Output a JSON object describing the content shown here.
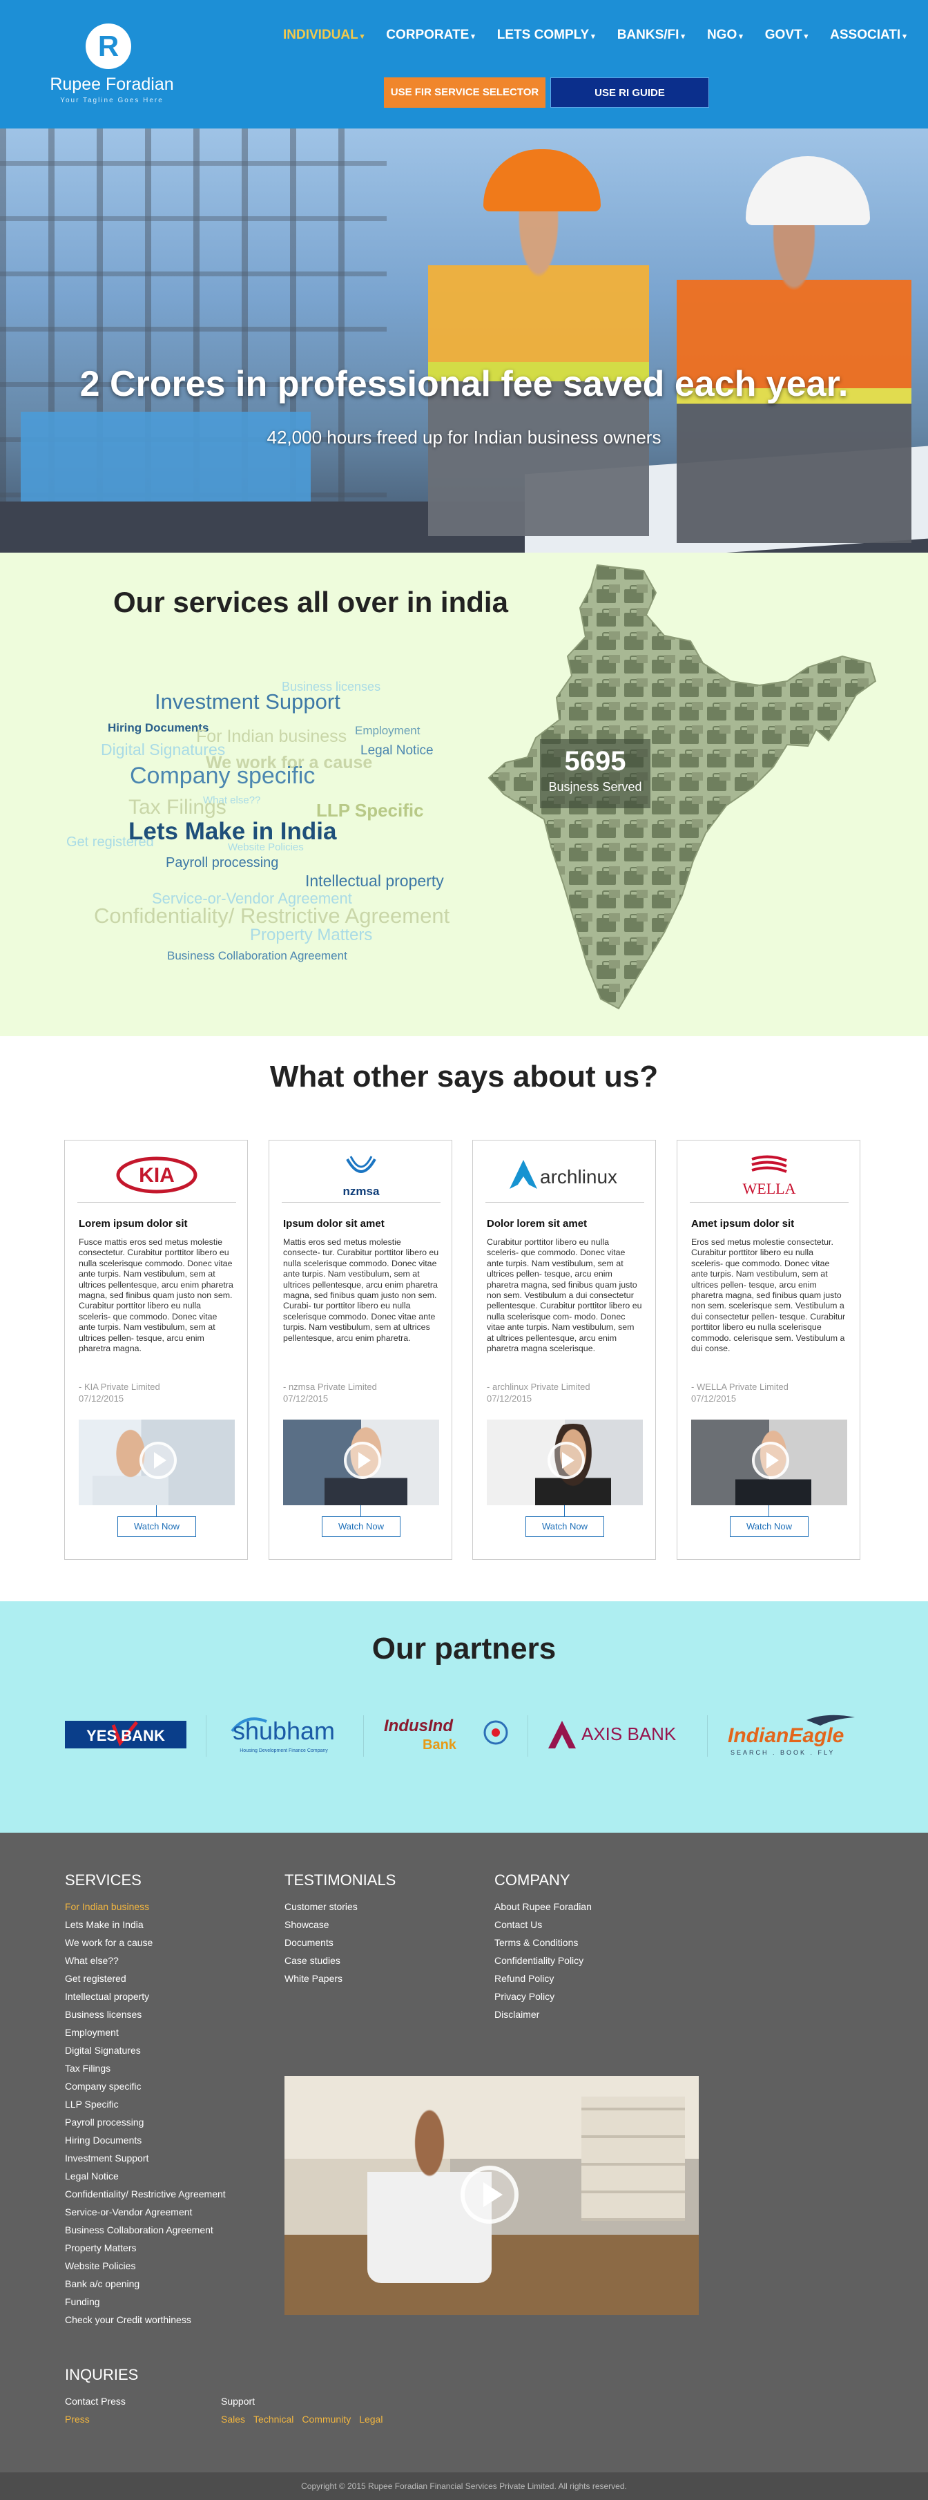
{
  "brand": {
    "initial": "R",
    "name": "Rupee Foradian",
    "tagline": "Your Tagline Goes Here",
    "color": "#1d8fd6"
  },
  "nav": {
    "items": [
      {
        "label": "INDIVIDUAL",
        "active": true
      },
      {
        "label": "CORPORATE"
      },
      {
        "label": "LETS COMPLY"
      },
      {
        "label": "BANKS/FI"
      },
      {
        "label": "NGO"
      },
      {
        "label": "GOVT"
      },
      {
        "label": "ASSOCIATI"
      }
    ],
    "caret": "▾",
    "fir_button": "USE FIR SERVICE SELECTOR",
    "ri_button": "USE RI GUIDE"
  },
  "hero": {
    "headline": "2 Crores in professional fee saved each year.",
    "subheadline": "42,000 hours freed up for Indian business owners"
  },
  "services": {
    "title": "Our services all over in india",
    "stat_number": "5695",
    "stat_label": "Busjness Served",
    "cloud": [
      "Business licenses",
      "Investment Support",
      "Hiring Documents",
      "Employment",
      "For Indian business",
      "Digital Signatures",
      "Legal Notice",
      "We work for a cause",
      "Company specific",
      "What else??",
      "Tax Filings",
      "LLP Specific",
      "Get registered",
      "Website Policies",
      "Lets Make in India",
      "Payroll processing",
      "Intellectual property",
      "Service-or-Vendor Agreement",
      "Confidentiality/ Restrictive Agreement",
      "Property Matters",
      "Business Collaboration Agreement"
    ]
  },
  "testimonials": {
    "title": "What other says about us?",
    "watch_label": "Watch Now",
    "cards": [
      {
        "logo": "KIA",
        "title": "Lorem ipsum dolor sit",
        "body": "Fusce mattis eros sed metus molestie consectetur. Curabitur porttitor libero eu nulla scelerisque commodo. Donec vitae ante turpis. Nam vestibulum, sem at ultrices pellentesque, arcu enim pharetra magna, sed finibus quam justo non sem. Curabitur porttitor libero eu nulla sceleris- que commodo. Donec vitae ante turpis. Nam vestibulum, sem at ultrices pellen- tesque, arcu enim pharetra magna.",
        "company": "- KIA Private Limited",
        "date": "07/12/2015"
      },
      {
        "logo": "nzmsa",
        "title": "Ipsum dolor sit amet",
        "body": "Mattis eros sed metus molestie consecte- tur. Curabitur porttitor libero eu nulla scelerisque commodo. Donec vitae ante turpis. Nam vestibulum, sem at ultrices pellentesque, arcu enim pharetra magna, sed finibus quam justo non sem. Curabi- tur porttitor libero eu nulla scelerisque commodo. Donec vitae ante turpis. Nam vestibulum, sem at ultrices pellentesque, arcu enim pharetra.",
        "company": "- nzmsa Private Limited",
        "date": "07/12/2015"
      },
      {
        "logo": "archlinux",
        "title": "Dolor lorem sit amet",
        "body": "Curabitur porttitor libero eu nulla sceleris- que commodo. Donec vitae ante turpis. Nam vestibulum, sem at ultrices pellen- tesque, arcu enim pharetra magna, sed finibus quam justo non sem. Vestibulum a dui consectetur pellentesque. Curabitur porttitor libero eu nulla scelerisque com- modo. Donec vitae ante turpis. Nam vestibulum, sem at ultrices pellentesque, arcu enim pharetra magna scelerisque.",
        "company": "- archlinux Private Limited",
        "date": "07/12/2015"
      },
      {
        "logo": "WELLA",
        "title": "Amet ipsum dolor sit",
        "body": "Eros sed metus molestie consectetur. Curabitur porttitor libero eu nulla sceleris- que commodo. Donec vitae ante turpis. Nam vestibulum, sem at ultrices pellen- tesque, arcu enim pharetra magna, sed finibus quam justo non sem. scelerisque sem. Vestibulum a dui consectetur pellen- tesque. Curabitur porttitor libero eu nulla scelerisque commodo. celerisque sem. Vestibulum a dui conse.",
        "company": "- WELLA Private Limited",
        "date": "07/12/2015"
      }
    ]
  },
  "partners": {
    "title": "Our partners",
    "logos": [
      {
        "text": "YES BANK"
      },
      {
        "text": "shubham",
        "sub": "Housing Development Finance Company"
      },
      {
        "text": "IndusInd",
        "sub": "Bank"
      },
      {
        "text": "AXIS BANK"
      },
      {
        "text": "IndianEagle",
        "sub": "SEARCH . BOOK . FLY"
      }
    ]
  },
  "footer": {
    "services_heading": "SERVICES",
    "services": [
      "For Indian business",
      "Lets Make in India",
      "We work for a cause",
      "What else??",
      "Get registered",
      "Intellectual property",
      "Business licenses",
      "Employment",
      "Digital Signatures",
      "Tax Filings",
      "Company specific",
      "LLP Specific",
      "Payroll processing",
      "Hiring Documents",
      "Investment Support",
      "Legal Notice",
      "Confidentiality/ Restrictive Agreement",
      "Service-or-Vendor Agreement",
      "Business Collaboration Agreement",
      "Property Matters",
      "Website Policies",
      "Bank a/c opening",
      "Funding",
      "Check your Credit worthiness"
    ],
    "testimonials_heading": "TESTIMONIALS",
    "testimonials": [
      "Customer stories",
      "Showcase",
      "Documents",
      "Case studies",
      "White Papers"
    ],
    "company_heading": "COMPANY",
    "company": [
      "About Rupee Foradian",
      "Contact Us",
      "Terms & Conditions",
      "Confidentiality Policy",
      "Refund Policy",
      "Privacy Policy",
      "Disclaimer"
    ],
    "inquiries_heading": "INQURIES",
    "contact_label": "Contact Press",
    "contact_link": "Press",
    "support_label": "Support",
    "support_links": [
      "Sales",
      "Technical",
      "Community",
      "Legal"
    ],
    "copyright": "Copyright © 2015 Rupee Foradian Financial Services Private Limited. All rights reserved."
  },
  "colors": {
    "header": "#1d8fd6",
    "orange": "#f0862c",
    "navy": "#0b2f8c",
    "services_bg": "#eefcdc",
    "partners_bg": "#aeeef1",
    "footer_bg": "#606060",
    "footer_highlight": "#f2b640"
  }
}
